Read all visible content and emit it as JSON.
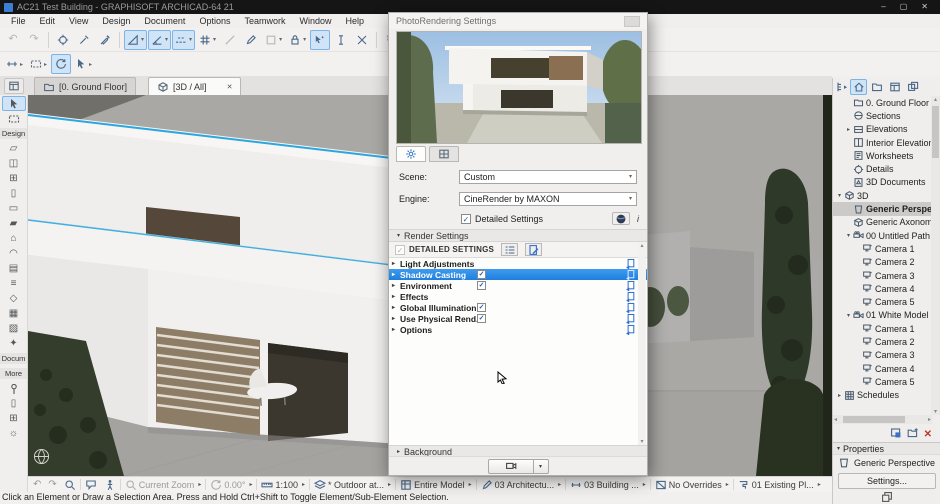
{
  "window": {
    "title": "AC21 Test Building - GRAPHISOFT ARCHICAD-64 21",
    "minimize": "–",
    "maximize": "▢",
    "close": "✕"
  },
  "menubar": {
    "items": [
      "File",
      "Edit",
      "View",
      "Design",
      "Document",
      "Options",
      "Teamwork",
      "Window",
      "Help"
    ]
  },
  "toolbar_main": {
    "items": [
      {
        "name": "undo",
        "glyph": "↶",
        "disabled": true
      },
      {
        "name": "redo",
        "glyph": "↷",
        "disabled": true
      },
      {
        "sep": true
      },
      {
        "name": "pick-up-parameters",
        "svg": "pickup"
      },
      {
        "name": "eyedropper",
        "svg": "eyedrop"
      },
      {
        "name": "inject-parameters",
        "svg": "syringe"
      },
      {
        "sep": true
      },
      {
        "name": "set-square",
        "svg": "setsquare",
        "active": true,
        "dd": true
      },
      {
        "name": "gravity",
        "svg": "angle",
        "active": true,
        "dd": true
      },
      {
        "name": "guide-lines",
        "svg": "guides",
        "active": true,
        "dd": true
      },
      {
        "name": "snap-grid",
        "svg": "snapgrid",
        "dd": true
      },
      {
        "name": "guide-segment",
        "svg": "linetool",
        "disabled": true
      },
      {
        "name": "pen",
        "svg": "pen"
      },
      {
        "name": "favorites",
        "svg": "shape",
        "dd": true,
        "disabled": true
      },
      {
        "name": "suspend-groups",
        "svg": "padlock",
        "dd": true
      },
      {
        "name": "magic-wand",
        "svg": "wand",
        "active": true
      },
      {
        "name": "text-cursor",
        "svg": "ibeam"
      },
      {
        "name": "stretch",
        "svg": "stretch"
      },
      {
        "sep": true
      },
      {
        "name": "split",
        "glyph": "✂"
      },
      {
        "name": "adjust",
        "svg": "mag"
      },
      {
        "name": "trim",
        "svg": "ibeam",
        "disabled": true
      }
    ]
  },
  "toolbar_secondary": {
    "items": [
      {
        "name": "virtual-trace",
        "svg": "dimchain",
        "dd": true
      },
      {
        "name": "trace-reference",
        "svg": "marquee",
        "dd": true
      },
      {
        "name": "orbit",
        "svg": "orbit",
        "active": true
      },
      {
        "name": "explore-select",
        "svg": "cursor",
        "dd": true
      }
    ]
  },
  "view_tabs": {
    "tabs": [
      {
        "label": "[0. Ground Floor]",
        "svg": "story",
        "active": false
      },
      {
        "label": "[3D / All]",
        "svg": "cube",
        "active": true,
        "close": "✕"
      }
    ]
  },
  "toolbox": {
    "groups": [
      {
        "label": "",
        "tools": [
          {
            "name": "select-tool",
            "svg": "cursor",
            "active": true
          },
          {
            "name": "marquee-tool",
            "svg": "marquee"
          }
        ]
      },
      {
        "label": "Design",
        "tools": [
          {
            "name": "wall-tool",
            "glyph": "▱"
          },
          {
            "name": "door-tool",
            "glyph": "◫"
          },
          {
            "name": "window-tool",
            "glyph": "⊞"
          },
          {
            "name": "column-tool",
            "glyph": "▯"
          },
          {
            "name": "beam-tool",
            "glyph": "▭"
          },
          {
            "name": "slab-tool",
            "glyph": "▰"
          },
          {
            "name": "roof-tool",
            "glyph": "⌂"
          },
          {
            "name": "shell-tool",
            "glyph": "◠"
          },
          {
            "name": "curtain-wall-tool",
            "glyph": "▤"
          },
          {
            "name": "stair-tool",
            "glyph": "≡"
          },
          {
            "name": "morph-tool",
            "glyph": "◇"
          },
          {
            "name": "mesh-tool",
            "glyph": "▦"
          },
          {
            "name": "zone-tool",
            "glyph": "▨"
          },
          {
            "name": "object-tool",
            "glyph": "✦"
          }
        ]
      },
      {
        "label": "Docum",
        "tools": []
      },
      {
        "label": "More",
        "tools": [
          {
            "name": "marker-tool",
            "svg": "marker"
          },
          {
            "name": "drawing-tool",
            "glyph": "▯"
          },
          {
            "name": "grid-tool",
            "glyph": "⊞"
          },
          {
            "name": "light-tool",
            "glyph": "☼"
          }
        ]
      }
    ]
  },
  "dialog": {
    "title": "PhotoRendering Settings",
    "tabs": [
      {
        "name": "settings-tab",
        "svg": "gear",
        "active": true
      },
      {
        "name": "size-tab",
        "svg": "gridtab",
        "active": false
      }
    ],
    "scene_label": "Scene:",
    "scene_value": "Custom",
    "engine_label": "Engine:",
    "engine_value": "CineRender by MAXON",
    "detailed_settings_label": "Detailed Settings",
    "detailed_settings_checked": true,
    "render_settings_label": "Render Settings",
    "detailed_settings_header": "DETAILED SETTINGS",
    "rows": [
      {
        "label": "Light Adjustments",
        "checkbox": false
      },
      {
        "label": "Shadow Casting",
        "checkbox": true,
        "checked": true,
        "selected": true
      },
      {
        "label": "Environment",
        "checkbox": true,
        "checked": true
      },
      {
        "label": "Effects",
        "checkbox": false
      },
      {
        "label": "Global Illumination",
        "checkbox": true,
        "checked": true
      },
      {
        "label": "Use Physical Rend...",
        "checkbox": true,
        "checked": true
      },
      {
        "label": "Options",
        "checkbox": false
      }
    ],
    "background_label": "Background"
  },
  "navigator": {
    "tabs": [
      {
        "name": "navigator-popup",
        "svg": "treepop",
        "pop": true
      },
      {
        "name": "project-map-tab",
        "svg": "home",
        "active": true
      },
      {
        "name": "view-map-tab",
        "svg": "folder"
      },
      {
        "name": "layout-book-tab",
        "svg": "layout"
      },
      {
        "name": "publisher-tab",
        "svg": "publisher"
      }
    ],
    "tree": [
      {
        "label": "0. Ground Floor",
        "svg": "story",
        "indent": 1
      },
      {
        "label": "Sections",
        "svg": "section",
        "indent": 1
      },
      {
        "label": "Elevations",
        "svg": "elevation",
        "indent": 1,
        "arrow": "collapsed"
      },
      {
        "label": "Interior Elevations",
        "svg": "intelev",
        "indent": 1
      },
      {
        "label": "Worksheets",
        "svg": "worksheet",
        "indent": 1
      },
      {
        "label": "Details",
        "svg": "detail",
        "indent": 1
      },
      {
        "label": "3D Documents",
        "svg": "doc3d",
        "indent": 1
      },
      {
        "label": "3D",
        "svg": "cube",
        "indent": 0,
        "arrow": "expanded"
      },
      {
        "label": "Generic Perspective",
        "svg": "persp",
        "indent": 1,
        "selected": true
      },
      {
        "label": "Generic Axonometr",
        "svg": "axo",
        "indent": 1
      },
      {
        "label": "00 Untitled Path",
        "svg": "pathcam",
        "indent": 1,
        "arrow": "expanded"
      },
      {
        "label": "Camera 1",
        "svg": "camera",
        "indent": 2
      },
      {
        "label": "Camera 2",
        "svg": "camera",
        "indent": 2
      },
      {
        "label": "Camera 3",
        "svg": "camera",
        "indent": 2
      },
      {
        "label": "Camera 4",
        "svg": "camera",
        "indent": 2
      },
      {
        "label": "Camera 5",
        "svg": "camera",
        "indent": 2
      },
      {
        "label": "01 White Model",
        "svg": "pathcam",
        "indent": 1,
        "arrow": "expanded"
      },
      {
        "label": "Camera 1",
        "svg": "camera",
        "indent": 2
      },
      {
        "label": "Camera 2",
        "svg": "camera",
        "indent": 2
      },
      {
        "label": "Camera 3",
        "svg": "camera",
        "indent": 2
      },
      {
        "label": "Camera 4",
        "svg": "camera",
        "indent": 2
      },
      {
        "label": "Camera 5",
        "svg": "camera",
        "indent": 2
      },
      {
        "label": "Schedules",
        "svg": "schedule",
        "indent": 0,
        "arrow": "collapsed"
      }
    ],
    "action_icons": [
      {
        "name": "save-current-view",
        "svg": "savewin"
      },
      {
        "name": "new-folder",
        "svg": "newfolder"
      },
      {
        "name": "delete-item",
        "glyph": "✕",
        "red": true
      }
    ],
    "properties_label": "Properties",
    "selected_item": "Generic Perspective",
    "settings_button": "Settings..."
  },
  "quickbar": {
    "items": [
      {
        "name": "previous-view",
        "glyph": "↶",
        "disabled": true
      },
      {
        "name": "next-view",
        "glyph": "↷",
        "disabled": true
      },
      {
        "name": "fit-in-window",
        "svg": "mag"
      },
      {
        "sep": true
      },
      {
        "name": "pan",
        "svg": "balloon"
      },
      {
        "name": "explore-model",
        "svg": "person"
      },
      {
        "sep": true
      },
      {
        "name": "zoom-level",
        "svg": "mag",
        "label": "Current Zoom",
        "dd": true,
        "disabled": true
      },
      {
        "sep": true
      },
      {
        "name": "orientation",
        "svg": "orbit",
        "label": "0.00°",
        "dd": true,
        "disabled": true
      },
      {
        "sep": true
      },
      {
        "name": "scale",
        "svg": "ruler",
        "label": "1:100",
        "dd": true
      },
      {
        "sep": true
      },
      {
        "name": "layer-combination",
        "svg": "layers",
        "label": "* Outdoor at...",
        "dd": true
      },
      {
        "sep": true
      },
      {
        "name": "model-filter",
        "svg": "modelf",
        "label": "Entire Model",
        "dd": true
      },
      {
        "sep": true
      },
      {
        "name": "pen-set",
        "svg": "pen",
        "label": "03 Architectu...",
        "dd": true
      },
      {
        "sep": true
      },
      {
        "name": "dimension-style",
        "svg": "dims",
        "label": "03 Building ...",
        "dd": true
      },
      {
        "sep": true
      },
      {
        "name": "graphic-override",
        "svg": "override",
        "label": "No Overrides",
        "dd": true
      },
      {
        "sep": true
      },
      {
        "name": "renovation-filter",
        "svg": "reno",
        "label": "01 Existing Pl...",
        "dd": true
      }
    ]
  },
  "statusbar": {
    "text": "Click an Element or Draw a Selection Area. Press and Hold Ctrl+Shift to Toggle Element/Sub-Element Selection."
  }
}
